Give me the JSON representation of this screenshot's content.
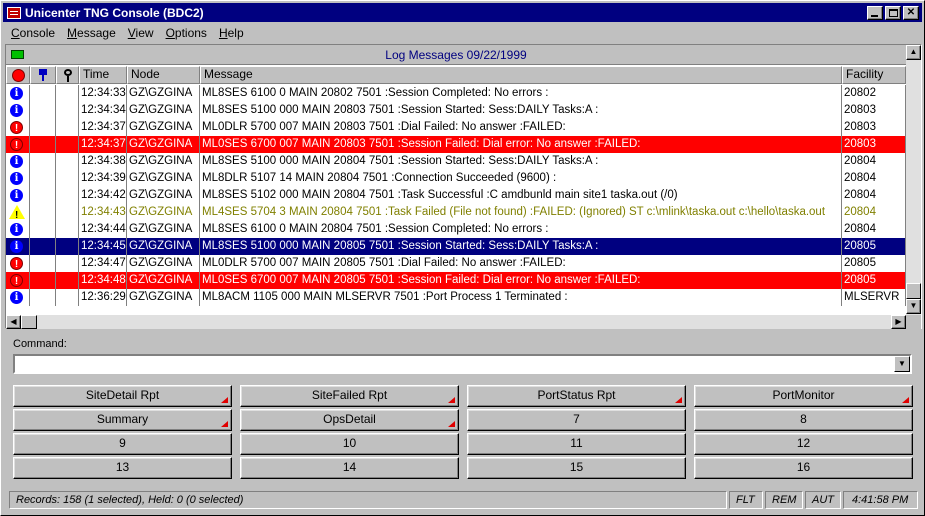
{
  "window": {
    "title": "Unicenter TNG Console (BDC2)"
  },
  "menu": [
    {
      "pre": "",
      "u": "C",
      "post": "onsole"
    },
    {
      "pre": "",
      "u": "M",
      "post": "essage"
    },
    {
      "pre": "",
      "u": "V",
      "post": "iew"
    },
    {
      "pre": "",
      "u": "O",
      "post": "ptions"
    },
    {
      "pre": "",
      "u": "H",
      "post": "elp"
    }
  ],
  "log": {
    "header": "Log Messages 09/22/1999",
    "columns": {
      "time": "Time",
      "node": "Node",
      "message": "Message",
      "facility": "Facility"
    },
    "rows": [
      {
        "icon": "info",
        "style": "",
        "time": "12:34:33",
        "node": "GZ\\GZGINA",
        "message": "ML8SES 6100 0 MAIN 20802 7501 :Session Completed: No errors :",
        "facility": "20802"
      },
      {
        "icon": "info",
        "style": "",
        "time": "12:34:34",
        "node": "GZ\\GZGINA",
        "message": "ML8SES 5100 000 MAIN 20803 7501 :Session Started: Sess:DAILY Tasks:A :",
        "facility": "20803"
      },
      {
        "icon": "stop",
        "style": "",
        "time": "12:34:37",
        "node": "GZ\\GZGINA",
        "message": "ML0DLR 5700 007 MAIN 20803 7501 :Dial Failed: No answer :FAILED:",
        "facility": "20803"
      },
      {
        "icon": "stop",
        "style": "red",
        "time": "12:34:37",
        "node": "GZ\\GZGINA",
        "message": "ML0SES 6700 007 MAIN 20803 7501 :Session Failed: Dial error: No answer :FAILED:",
        "facility": "20803"
      },
      {
        "icon": "info",
        "style": "",
        "time": "12:34:38",
        "node": "GZ\\GZGINA",
        "message": "ML8SES 5100 000 MAIN 20804 7501 :Session Started: Sess:DAILY Tasks:A :",
        "facility": "20804"
      },
      {
        "icon": "info",
        "style": "",
        "time": "12:34:39",
        "node": "GZ\\GZGINA",
        "message": "ML8DLR 5107 14 MAIN 20804 7501 :Connection Succeeded (9600) :",
        "facility": "20804"
      },
      {
        "icon": "info",
        "style": "",
        "time": "12:34:42",
        "node": "GZ\\GZGINA",
        "message": "ML8SES 5102 000 MAIN 20804 7501 :Task Successful :C amdbunld main site1 taska.out (/0)",
        "facility": "20804"
      },
      {
        "icon": "warn",
        "style": "warn",
        "time": "12:34:43",
        "node": "GZ\\GZGINA",
        "message": "ML4SES 5704 3 MAIN 20804 7501 :Task Failed (File not found) :FAILED: (Ignored) ST c:\\mlink\\taska.out c:\\hello\\taska.out",
        "facility": "20804"
      },
      {
        "icon": "info",
        "style": "",
        "time": "12:34:44",
        "node": "GZ\\GZGINA",
        "message": "ML8SES 6100 0 MAIN 20804 7501 :Session Completed: No errors :",
        "facility": "20804"
      },
      {
        "icon": "info",
        "style": "sel",
        "time": "12:34:45",
        "node": "GZ\\GZGINA",
        "message": "ML8SES 5100 000 MAIN 20805 7501 :Session Started: Sess:DAILY Tasks:A :",
        "facility": "20805"
      },
      {
        "icon": "stop",
        "style": "",
        "time": "12:34:47",
        "node": "GZ\\GZGINA",
        "message": "ML0DLR 5700 007 MAIN 20805 7501 :Dial Failed: No answer :FAILED:",
        "facility": "20805"
      },
      {
        "icon": "stop",
        "style": "red",
        "time": "12:34:48",
        "node": "GZ\\GZGINA",
        "message": "ML0SES 6700 007 MAIN 20805 7501 :Session Failed: Dial error: No answer :FAILED:",
        "facility": "20805"
      },
      {
        "icon": "info",
        "style": "",
        "time": "12:36:29",
        "node": "GZ\\GZGINA",
        "message": "ML8ACM 1105 000 MAIN MLSERVR 7501 :Port Process 1 Terminated :",
        "facility": "MLSERVR"
      }
    ]
  },
  "command": {
    "label": "Command:",
    "value": ""
  },
  "buttons": [
    {
      "label": "SiteDetail Rpt",
      "marker": true
    },
    {
      "label": "SiteFailed Rpt",
      "marker": true
    },
    {
      "label": "PortStatus Rpt",
      "marker": true
    },
    {
      "label": "PortMonitor",
      "marker": true
    },
    {
      "label": "Summary",
      "marker": true
    },
    {
      "label": "OpsDetail",
      "marker": true
    },
    {
      "label": "7",
      "marker": false
    },
    {
      "label": "8",
      "marker": false
    },
    {
      "label": "9",
      "marker": false
    },
    {
      "label": "10",
      "marker": false
    },
    {
      "label": "11",
      "marker": false
    },
    {
      "label": "12",
      "marker": false
    },
    {
      "label": "13",
      "marker": false
    },
    {
      "label": "14",
      "marker": false
    },
    {
      "label": "15",
      "marker": false
    },
    {
      "label": "16",
      "marker": false
    }
  ],
  "status": {
    "records": "Records: 158 (1 selected), Held: 0 (0 selected)",
    "flt": "FLT",
    "rem": "REM",
    "aut": "AUT",
    "clock": "4:41:58 PM"
  },
  "colors": {
    "title_bg": "#000080",
    "error_row": "#ff0000",
    "warn_text": "#808000",
    "selected_row": "#000080"
  }
}
